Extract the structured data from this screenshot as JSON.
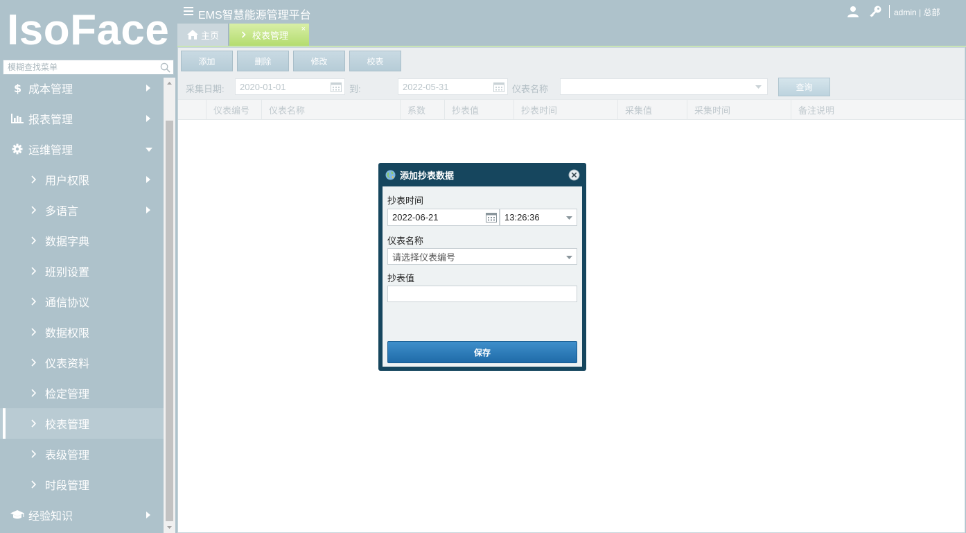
{
  "sidebar": {
    "logo": "IsoFace",
    "search_placeholder": "模糊查找菜单",
    "items": [
      {
        "label": "成本管理",
        "icon": "dollar-icon",
        "level": "top",
        "arrow": "right"
      },
      {
        "label": "报表管理",
        "icon": "bar-chart-icon",
        "level": "top",
        "arrow": "right"
      },
      {
        "label": "运维管理",
        "icon": "gear-icon",
        "level": "top",
        "arrow": "down"
      },
      {
        "label": "用户权限",
        "level": "sub",
        "arrow": "right"
      },
      {
        "label": "多语言",
        "level": "sub",
        "arrow": "right"
      },
      {
        "label": "数据字典",
        "level": "sub"
      },
      {
        "label": "班别设置",
        "level": "sub"
      },
      {
        "label": "通信协议",
        "level": "sub"
      },
      {
        "label": "数据权限",
        "level": "sub"
      },
      {
        "label": "仪表资料",
        "level": "sub"
      },
      {
        "label": "检定管理",
        "level": "sub"
      },
      {
        "label": "校表管理",
        "level": "sub",
        "active": true
      },
      {
        "label": "表级管理",
        "level": "sub"
      },
      {
        "label": "时段管理",
        "level": "sub"
      },
      {
        "label": "经验知识",
        "icon": "graduation-cap-icon",
        "level": "top",
        "arrow": "right"
      }
    ]
  },
  "header": {
    "title": "EMS智慧能源管理平台",
    "user": "admin",
    "org": "总部"
  },
  "tabs": [
    {
      "label": "主页",
      "icon": "home-icon"
    },
    {
      "label": "校表管理",
      "active": true,
      "close": "×"
    }
  ],
  "toolbar": {
    "add": "添加",
    "delete": "删除",
    "edit": "修改",
    "calibrate": "校表"
  },
  "filter": {
    "date_label": "采集日期:",
    "start_date": "2020-01-01",
    "to_label": "到:",
    "end_date": "2022-05-31",
    "meter_name_label": "仪表名称",
    "meter_name_value": "",
    "query": "查询"
  },
  "table": {
    "columns": [
      "仪表编号",
      "仪表名称",
      "系数",
      "抄表值",
      "抄表时间",
      "采集值",
      "采集时间",
      "备注说明"
    ]
  },
  "modal": {
    "title": "添加抄表数据",
    "time_label": "抄表时间",
    "date_value": "2022-06-21",
    "time_value": "13:26:36",
    "meter_label": "仪表名称",
    "meter_placeholder": "请选择仪表编号",
    "value_label": "抄表值",
    "value": "",
    "save": "保存"
  },
  "colors": {
    "sidebar_bg": "#aec2cb",
    "modal_frame": "#16465e",
    "save_button": "#2a7cbc",
    "active_tab": "#b4dc6f"
  }
}
